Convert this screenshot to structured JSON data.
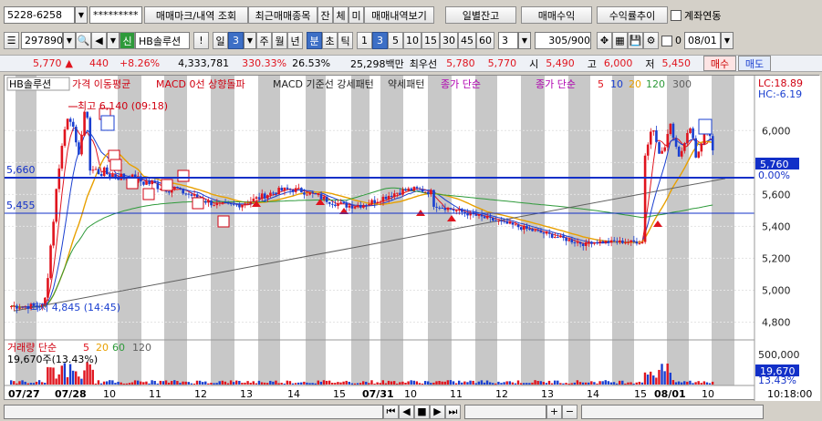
{
  "toolbar1": {
    "account": "5228-6258",
    "password": "*********",
    "trade_btn": "매매마크/내역 조회",
    "recent_btn": "최근매매종목",
    "jan_btn": "잔",
    "che_btn": "체",
    "mi_btn": "미",
    "history_btn": "매매내역보기",
    "daily_btn": "일별잔고",
    "profit_btn": "매매수익",
    "rate_btn": "수익률추이",
    "link_label": "계좌연동"
  },
  "toolbar2": {
    "code": "297890",
    "badge": "신",
    "name": "HB솔루션",
    "excl": "!",
    "il": "일",
    "il_num": "3",
    "periods": [
      "주",
      "월",
      "년"
    ],
    "minute_tabs": [
      "분",
      "초",
      "틱"
    ],
    "intervals": [
      "1",
      "3",
      "5",
      "10",
      "15",
      "30",
      "45",
      "60"
    ],
    "selected_interval": "3",
    "count": "3",
    "range": "305",
    "range_total": "/900",
    "zero": "0",
    "date": "08/01"
  },
  "quote": {
    "price": "5,770",
    "arrow": "▲",
    "change": "440",
    "change_rate": "+8.26%",
    "volume": "4,333,781",
    "vol_ratio": "330.33%",
    "turnover": "26.53%",
    "amount": "25,298백만",
    "best_label": "최우선",
    "best_ask": "5,780",
    "best_bid": "5,770",
    "open_label": "시",
    "open": "5,490",
    "high_label": "고",
    "high": "6,000",
    "low_label": "저",
    "low": "5,450",
    "buy": "매수",
    "sell": "매도"
  },
  "legend": {
    "stock": "HB솔루션",
    "ma": "가격 이동평균",
    "macd0": "MACD 0선 상향돌파",
    "macdbase": "MACD 기준선 강세패턴",
    "weak": "약세패턴",
    "close": "종가 단순",
    "close2": "종가 단순",
    "p5": "5",
    "p10": "10",
    "p20": "20",
    "p120": "120",
    "p300": "300"
  },
  "annot": {
    "high": "최고 6,140 (09:18)",
    "low": "최저 4,845 (14:45)",
    "line1": "5,660",
    "line2": "5,455"
  },
  "right_axis": {
    "lc": "LC:18.89",
    "hc": "HC:-6.19",
    "ticks": [
      "6,000",
      "5,800",
      "5,600",
      "5,400",
      "5,200",
      "5,000",
      "4,800"
    ],
    "cur_price": "5,760",
    "cur_pct": "0.00%",
    "vol_tick": "500,000",
    "vol_zero": "0",
    "vol_cur": "19,670",
    "vol_pct": "13.43%"
  },
  "volume_legend": {
    "title": "거래량 단순",
    "p5": "5",
    "p20": "20",
    "p60": "60",
    "p120": "120",
    "value": "19,670주(13.43%)"
  },
  "x_axis": {
    "labels": [
      "07/27",
      "07/28",
      "10",
      "11",
      "12",
      "13",
      "14",
      "15",
      "07/31",
      "10",
      "11",
      "12",
      "13",
      "14",
      "15",
      "08/01",
      "10"
    ],
    "time": "10:18:00"
  },
  "colors": {
    "candle_up": "#e0141e",
    "candle_down": "#1a3fd0",
    "ma5": "#e0141e",
    "ma10": "#1a3fd0",
    "ma20": "#e8a000",
    "ma120": "#2e9a3a",
    "ma300": "#606060",
    "line": "#1230c8"
  },
  "chart_data": {
    "type": "candlestick",
    "ylim": [
      4700,
      6230
    ],
    "price_ticks": [
      6000,
      5800,
      5600,
      5400,
      5200,
      5000,
      4800
    ],
    "hlines": [
      5660,
      5455
    ],
    "annotations": {
      "high": 6140,
      "low": 4845
    },
    "series_names": [
      "5",
      "10",
      "20",
      "120"
    ],
    "session_boundary_x": [
      0,
      48,
      387,
      712
    ]
  }
}
